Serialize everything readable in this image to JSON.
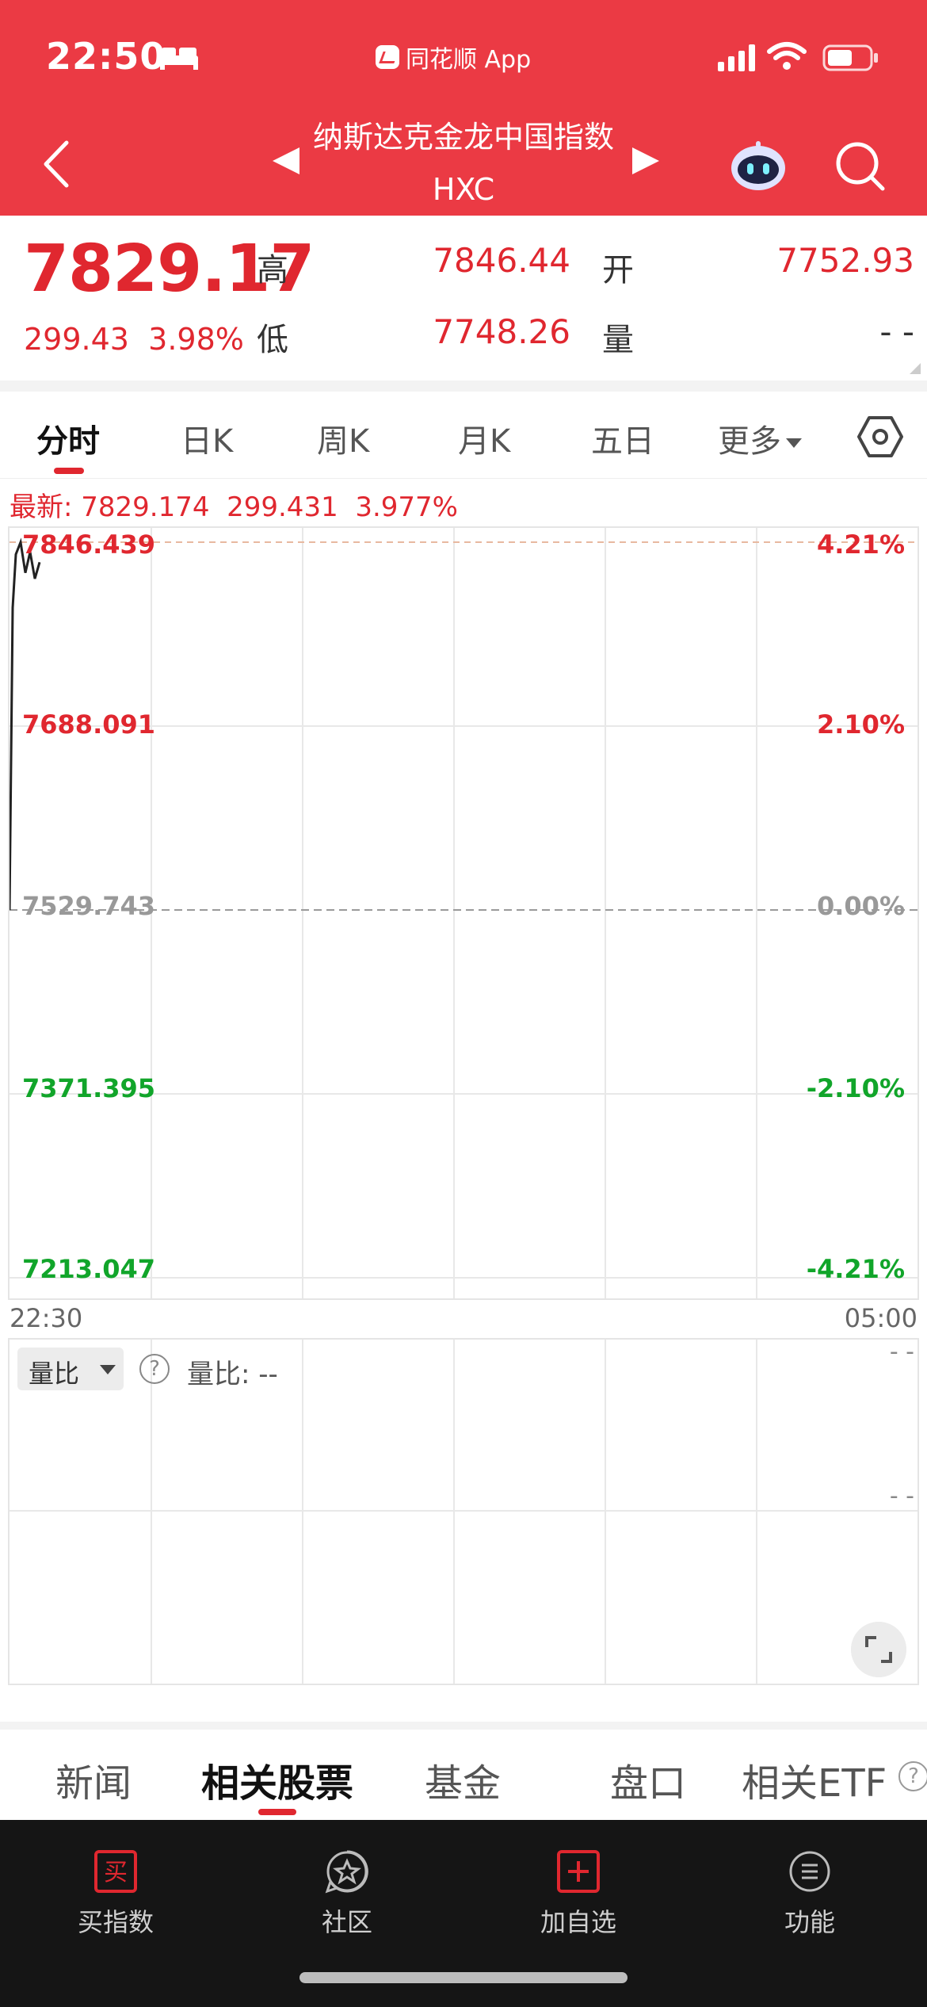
{
  "status_bar": {
    "time": "22:50",
    "app_name": "同花顺 App"
  },
  "nav": {
    "title": "纳斯达克金龙中国指数",
    "code": "HXC"
  },
  "quote": {
    "price": "7829.17",
    "change": "299.43",
    "change_pct": "3.98%",
    "high_label": "高",
    "high": "7846.44",
    "low_label": "低",
    "low": "7748.26",
    "open_label": "开",
    "open": "7752.93",
    "volume_label": "量",
    "volume": "- -"
  },
  "tabs": [
    "分时",
    "日K",
    "周K",
    "月K",
    "五日",
    "更多"
  ],
  "latest_line": "最新: 7829.174  299.431  3.977%",
  "chart_data": {
    "type": "line",
    "x_start": "22:30",
    "x_end": "05:00",
    "y_ticks_left": [
      "7846.439",
      "7688.091",
      "7529.743",
      "7371.395",
      "7213.047"
    ],
    "y_ticks_right": [
      "4.21%",
      "2.10%",
      "0.00%",
      "-2.10%",
      "-4.21%"
    ],
    "ylim": [
      7213.047,
      7846.439
    ],
    "prev_close": 7529.743,
    "series": [
      {
        "values": [
          7529.7,
          7790.0,
          7836.0,
          7846.4,
          7820.0,
          7838.0,
          7815.0,
          7829.2
        ]
      }
    ]
  },
  "volume_panel": {
    "selector": "量比",
    "help": "?",
    "label": "量比: --",
    "dash": "- -"
  },
  "bottom_tabs": [
    "新闻",
    "相关股票",
    "基金",
    "盘口",
    "相关ETF"
  ],
  "toolbar": [
    {
      "label": "买指数",
      "icon": "buy-icon"
    },
    {
      "label": "社区",
      "icon": "community-icon"
    },
    {
      "label": "加自选",
      "icon": "add-watchlist-icon"
    },
    {
      "label": "功能",
      "icon": "menu-icon"
    }
  ],
  "colors": {
    "header_red": "#eb3a44",
    "up": "#e0272f",
    "down": "#11a52a"
  }
}
